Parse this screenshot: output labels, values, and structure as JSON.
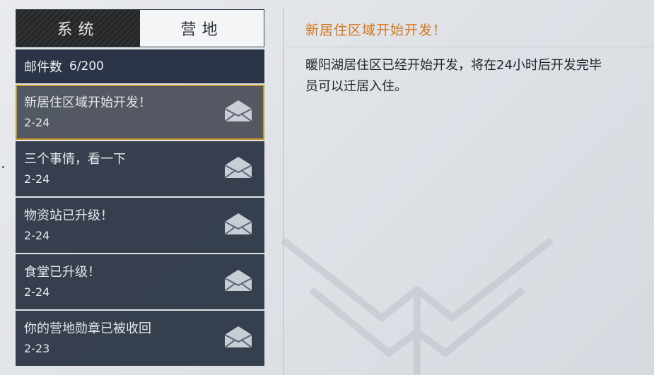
{
  "tabs": {
    "system_label": "系统",
    "camp_label": "营地",
    "active": "camp"
  },
  "mailbox": {
    "label": "邮件数",
    "count": "6/200"
  },
  "mails": [
    {
      "title": "新居住区域开始开发！",
      "date": "2-24",
      "selected": true,
      "icon": "envelope-icon"
    },
    {
      "title": "三个事情，看一下",
      "date": "2-24",
      "selected": false,
      "icon": "envelope-icon"
    },
    {
      "title": "物资站已升级！",
      "date": "2-24",
      "selected": false,
      "icon": "envelope-icon"
    },
    {
      "title": "食堂已升级！",
      "date": "2-24",
      "selected": false,
      "icon": "envelope-icon"
    },
    {
      "title": "你的营地勋章已被收回",
      "date": "2-23",
      "selected": false,
      "icon": "envelope-icon"
    }
  ],
  "detail": {
    "title": "新居住区域开始开发！",
    "body_line1": "暖阳湖居住区已经开始开发，将在24小时后开发完毕",
    "body_line2": "员可以迁居入住。"
  },
  "colors": {
    "accent": "#d4781f",
    "selected_border": "#c8962e",
    "list_bg": "#2c3444"
  }
}
